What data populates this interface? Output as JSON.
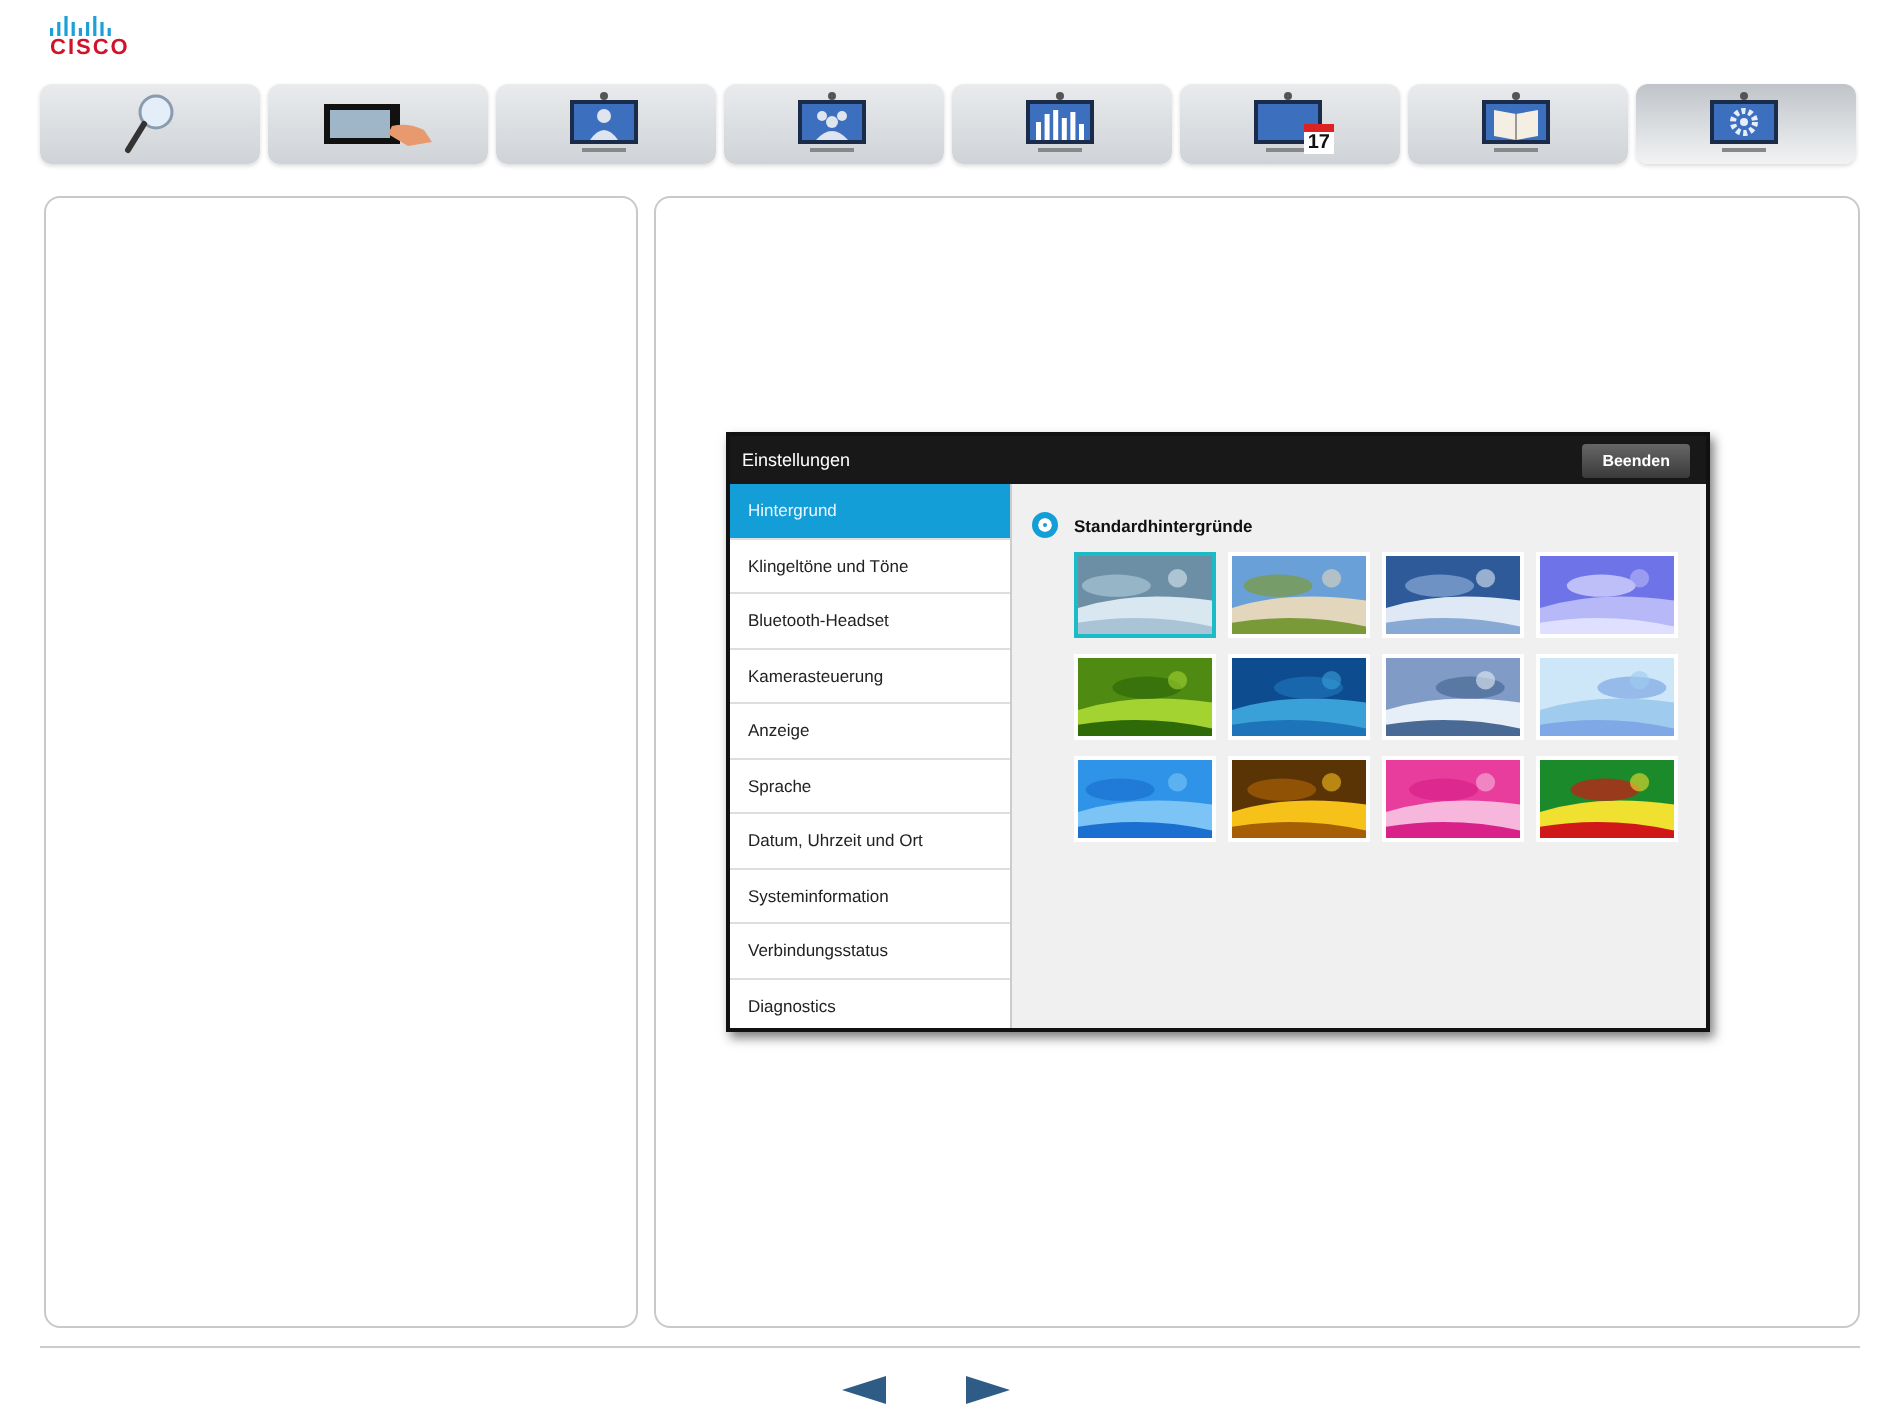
{
  "logo": {
    "text": "CISCO"
  },
  "tabs": [
    {
      "kind": "search",
      "selected": false
    },
    {
      "kind": "touch",
      "selected": false
    },
    {
      "kind": "person",
      "selected": false
    },
    {
      "kind": "group",
      "selected": false
    },
    {
      "kind": "chart",
      "selected": false
    },
    {
      "kind": "calendar",
      "selected": false,
      "date": "17"
    },
    {
      "kind": "book",
      "selected": false
    },
    {
      "kind": "gear",
      "selected": true
    }
  ],
  "screenshot": {
    "title": "Einstellungen",
    "close_button": "Beenden",
    "menu": [
      {
        "label": "Hintergrund",
        "selected": true
      },
      {
        "label": "Klingeltöne und Töne",
        "selected": false
      },
      {
        "label": "Bluetooth-Headset",
        "selected": false
      },
      {
        "label": "Kamerasteuerung",
        "selected": false
      },
      {
        "label": "Anzeige",
        "selected": false
      },
      {
        "label": "Sprache",
        "selected": false
      },
      {
        "label": "Datum, Uhrzeit und Ort",
        "selected": false
      },
      {
        "label": "Systeminformation",
        "selected": false
      },
      {
        "label": "Verbindungsstatus",
        "selected": false
      },
      {
        "label": "Diagnostics",
        "selected": false
      }
    ],
    "option": {
      "label": "Standardhintergründe",
      "selected": true
    },
    "thumbnails": [
      {
        "kind": "picture",
        "selected": true
      },
      {
        "kind": "picture",
        "selected": false
      },
      {
        "kind": "picture",
        "selected": false
      },
      {
        "kind": "picture",
        "selected": false
      },
      {
        "kind": "picture",
        "selected": false
      },
      {
        "kind": "picture",
        "selected": false
      },
      {
        "kind": "picture",
        "selected": false
      },
      {
        "kind": "picture",
        "selected": false
      },
      {
        "kind": "picture",
        "selected": false
      },
      {
        "kind": "picture",
        "selected": false
      },
      {
        "kind": "picture",
        "selected": false
      },
      {
        "kind": "picture",
        "selected": false
      }
    ]
  },
  "pager": {
    "previous": {
      "disabled": false
    },
    "next": {
      "disabled": false
    }
  }
}
